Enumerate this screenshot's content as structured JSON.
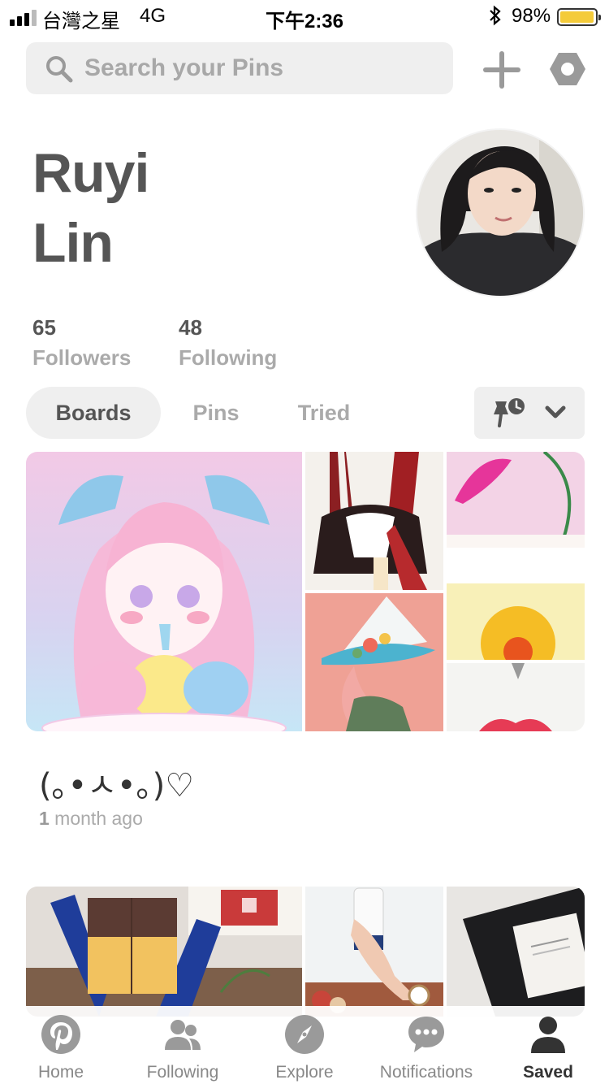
{
  "status_bar": {
    "carrier": "台灣之星",
    "network": "4G",
    "time": "下午2:36",
    "battery": "98%",
    "battery_level": 0.98,
    "battery_color": "#f4cb3a"
  },
  "search": {
    "placeholder": "Search your Pins"
  },
  "profile": {
    "first_name": "Ruyi",
    "last_name": "Lin",
    "followers_count": "65",
    "followers_label": "Followers",
    "following_count": "48",
    "following_label": "Following"
  },
  "tabs": [
    {
      "label": "Boards",
      "active": true
    },
    {
      "label": "Pins",
      "active": false
    },
    {
      "label": "Tried",
      "active": false
    }
  ],
  "boards": [
    {
      "title": "(｡•ㅅ•｡)♡",
      "time_count": "1",
      "time_unit": " month ago"
    },
    {
      "title": "",
      "time_count": "",
      "time_unit": ""
    }
  ],
  "bottom_nav": [
    {
      "label": "Home",
      "icon": "pinterest-icon",
      "active": false
    },
    {
      "label": "Following",
      "icon": "people-icon",
      "active": false
    },
    {
      "label": "Explore",
      "icon": "compass-icon",
      "active": false
    },
    {
      "label": "Notifications",
      "icon": "speech-bubble-icon",
      "active": false
    },
    {
      "label": "Saved",
      "icon": "person-icon",
      "active": true
    }
  ],
  "colors": {
    "pinterest_red": "#bd081c",
    "text_dark": "#555555",
    "text_muted": "#aaaaaa",
    "chip_bg": "#efefef"
  }
}
